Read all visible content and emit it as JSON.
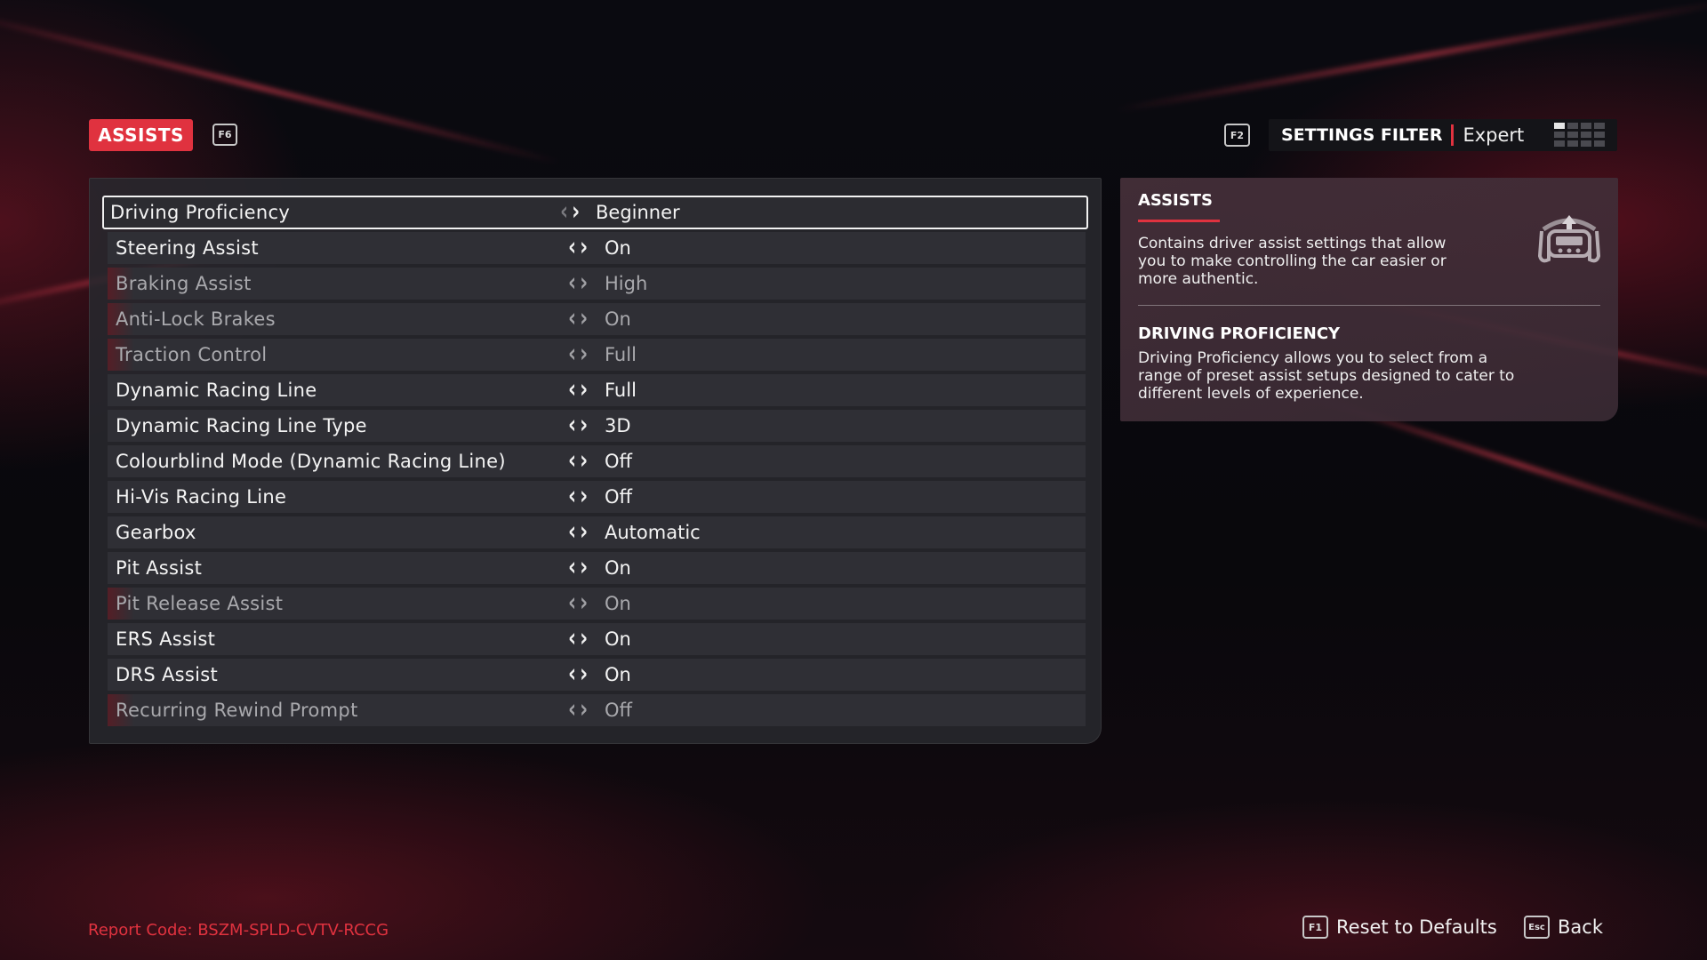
{
  "colors": {
    "accent": "#e0323f",
    "row_bg": "#2f2f35",
    "panel_bg": "#28282e"
  },
  "header": {
    "tab_label": "ASSISTS",
    "tab_key": "F6",
    "filter_key": "F2",
    "filter_title": "SETTINGS FILTER",
    "filter_value": "Expert",
    "filter_icon": "grid-level-icon"
  },
  "settings": {
    "rows": [
      {
        "label": "Driving Proficiency",
        "value": "Beginner",
        "state": "selected"
      },
      {
        "label": "Steering Assist",
        "value": "On",
        "state": "normal"
      },
      {
        "label": "Braking Assist",
        "value": "High",
        "state": "dim"
      },
      {
        "label": "Anti-Lock Brakes",
        "value": "On",
        "state": "dim"
      },
      {
        "label": "Traction Control",
        "value": "Full",
        "state": "dim"
      },
      {
        "label": "Dynamic Racing Line",
        "value": "Full",
        "state": "normal"
      },
      {
        "label": "Dynamic Racing Line Type",
        "value": "3D",
        "state": "normal"
      },
      {
        "label": "Colourblind Mode (Dynamic Racing Line)",
        "value": "Off",
        "state": "normal"
      },
      {
        "label": "Hi-Vis Racing Line",
        "value": "Off",
        "state": "normal"
      },
      {
        "label": "Gearbox",
        "value": "Automatic",
        "state": "normal"
      },
      {
        "label": "Pit Assist",
        "value": "On",
        "state": "normal"
      },
      {
        "label": "Pit Release Assist",
        "value": "On",
        "state": "dim"
      },
      {
        "label": "ERS Assist",
        "value": "On",
        "state": "normal"
      },
      {
        "label": "DRS Assist",
        "value": "On",
        "state": "normal"
      },
      {
        "label": "Recurring Rewind Prompt",
        "value": "Off",
        "state": "dim"
      }
    ]
  },
  "info": {
    "section_title": "ASSISTS",
    "section_lines": [
      "Contains driver assist settings that allow",
      "you to make controlling the car easier or",
      "more authentic."
    ],
    "icon": "steering-wheel-icon",
    "item_title": "DRIVING PROFICIENCY",
    "item_lines": [
      "Driving Proficiency allows you to select from a",
      "range of preset assist setups designed to cater to",
      "different levels of experience."
    ]
  },
  "footer": {
    "report_code": "Report Code: BSZM-SPLD-CVTV-RCCG",
    "reset_key": "F1",
    "reset_label": "Reset to Defaults",
    "back_key": "Esc",
    "back_label": "Back"
  }
}
